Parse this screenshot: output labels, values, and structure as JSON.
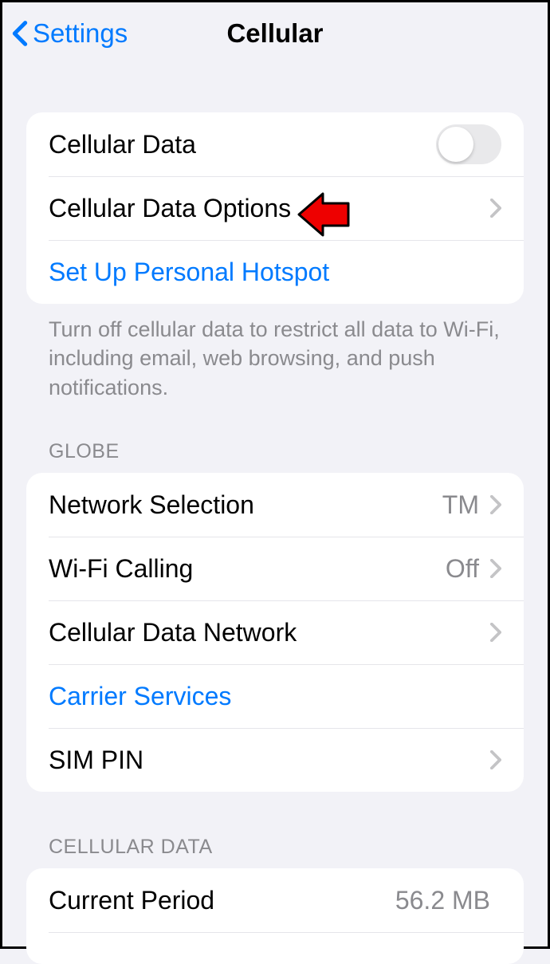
{
  "nav": {
    "back_label": "Settings",
    "title": "Cellular"
  },
  "section1": {
    "cellular_data_label": "Cellular Data",
    "cellular_data_on": false,
    "cellular_data_options_label": "Cellular Data Options",
    "personal_hotspot_label": "Set Up Personal Hotspot",
    "footer": "Turn off cellular data to restrict all data to Wi-Fi, including email, web browsing, and push notifications."
  },
  "section2": {
    "header": "GLOBE",
    "network_selection_label": "Network Selection",
    "network_selection_value": "TM",
    "wifi_calling_label": "Wi-Fi Calling",
    "wifi_calling_value": "Off",
    "cellular_data_network_label": "Cellular Data Network",
    "carrier_services_label": "Carrier Services",
    "sim_pin_label": "SIM PIN"
  },
  "section3": {
    "header": "CELLULAR DATA",
    "current_period_label": "Current Period",
    "current_period_value": "56.2 MB"
  }
}
